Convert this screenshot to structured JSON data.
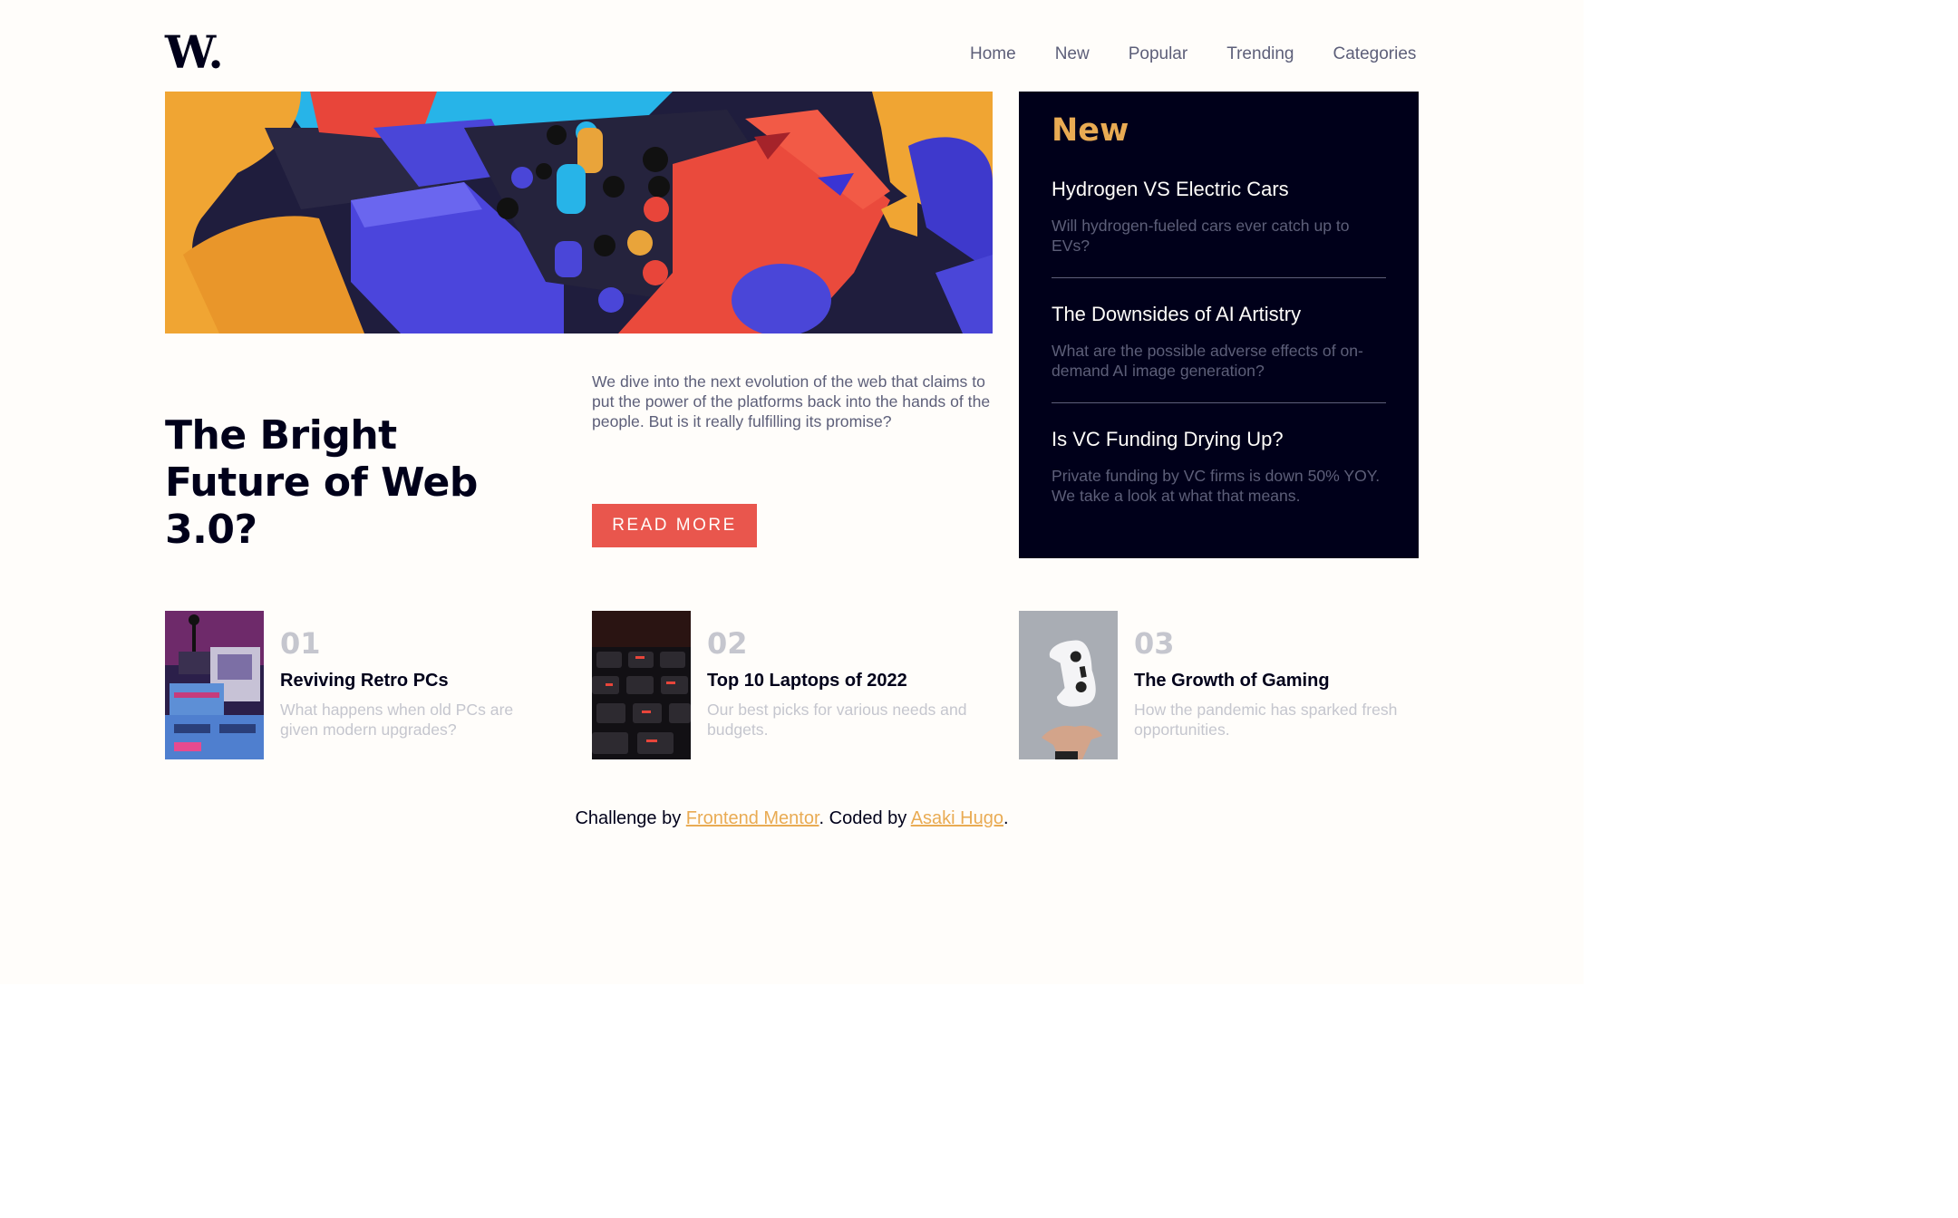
{
  "brand": {
    "logo": "W."
  },
  "nav": {
    "items": [
      "Home",
      "New",
      "Popular",
      "Trending",
      "Categories"
    ]
  },
  "hero": {
    "headline": "The Bright Future of Web 3.0?",
    "intro": "We dive into the next evolution of the web that claims to put the power of the platforms back into the hands of the people. But is it really fulfilling its promise?",
    "cta": "READ MORE"
  },
  "new_panel": {
    "title": "New",
    "items": [
      {
        "title": "Hydrogen VS Electric Cars",
        "desc": "Will hydrogen-fueled cars ever catch up to EVs?"
      },
      {
        "title": "The Downsides of AI Artistry",
        "desc": "What are the possible adverse effects of on-demand AI image generation?"
      },
      {
        "title": "Is VC Funding Drying Up?",
        "desc": "Private funding by VC firms is down 50% YOY. We take a look at what that means."
      }
    ]
  },
  "cards": [
    {
      "num": "01",
      "title": "Reviving Retro PCs",
      "desc": "What happens when old PCs are given modern upgrades?"
    },
    {
      "num": "02",
      "title": "Top 10 Laptops of 2022",
      "desc": "Our best picks for various needs and budgets."
    },
    {
      "num": "03",
      "title": "The Growth of Gaming",
      "desc": "How the pandemic has sparked fresh opportunities."
    }
  ],
  "footer": {
    "prefix": "Challenge by ",
    "link1": "Frontend Mentor",
    "middle": ". Coded by ",
    "link2": "Asaki Hugo",
    "suffix": "."
  },
  "colors": {
    "background": "#fffdfa",
    "dark": "#00001a",
    "accent_orange": "#e9ab53",
    "accent_red": "#e9564d",
    "grayish_blue": "#5d5f79",
    "grayish_light": "#c5c6ce"
  }
}
